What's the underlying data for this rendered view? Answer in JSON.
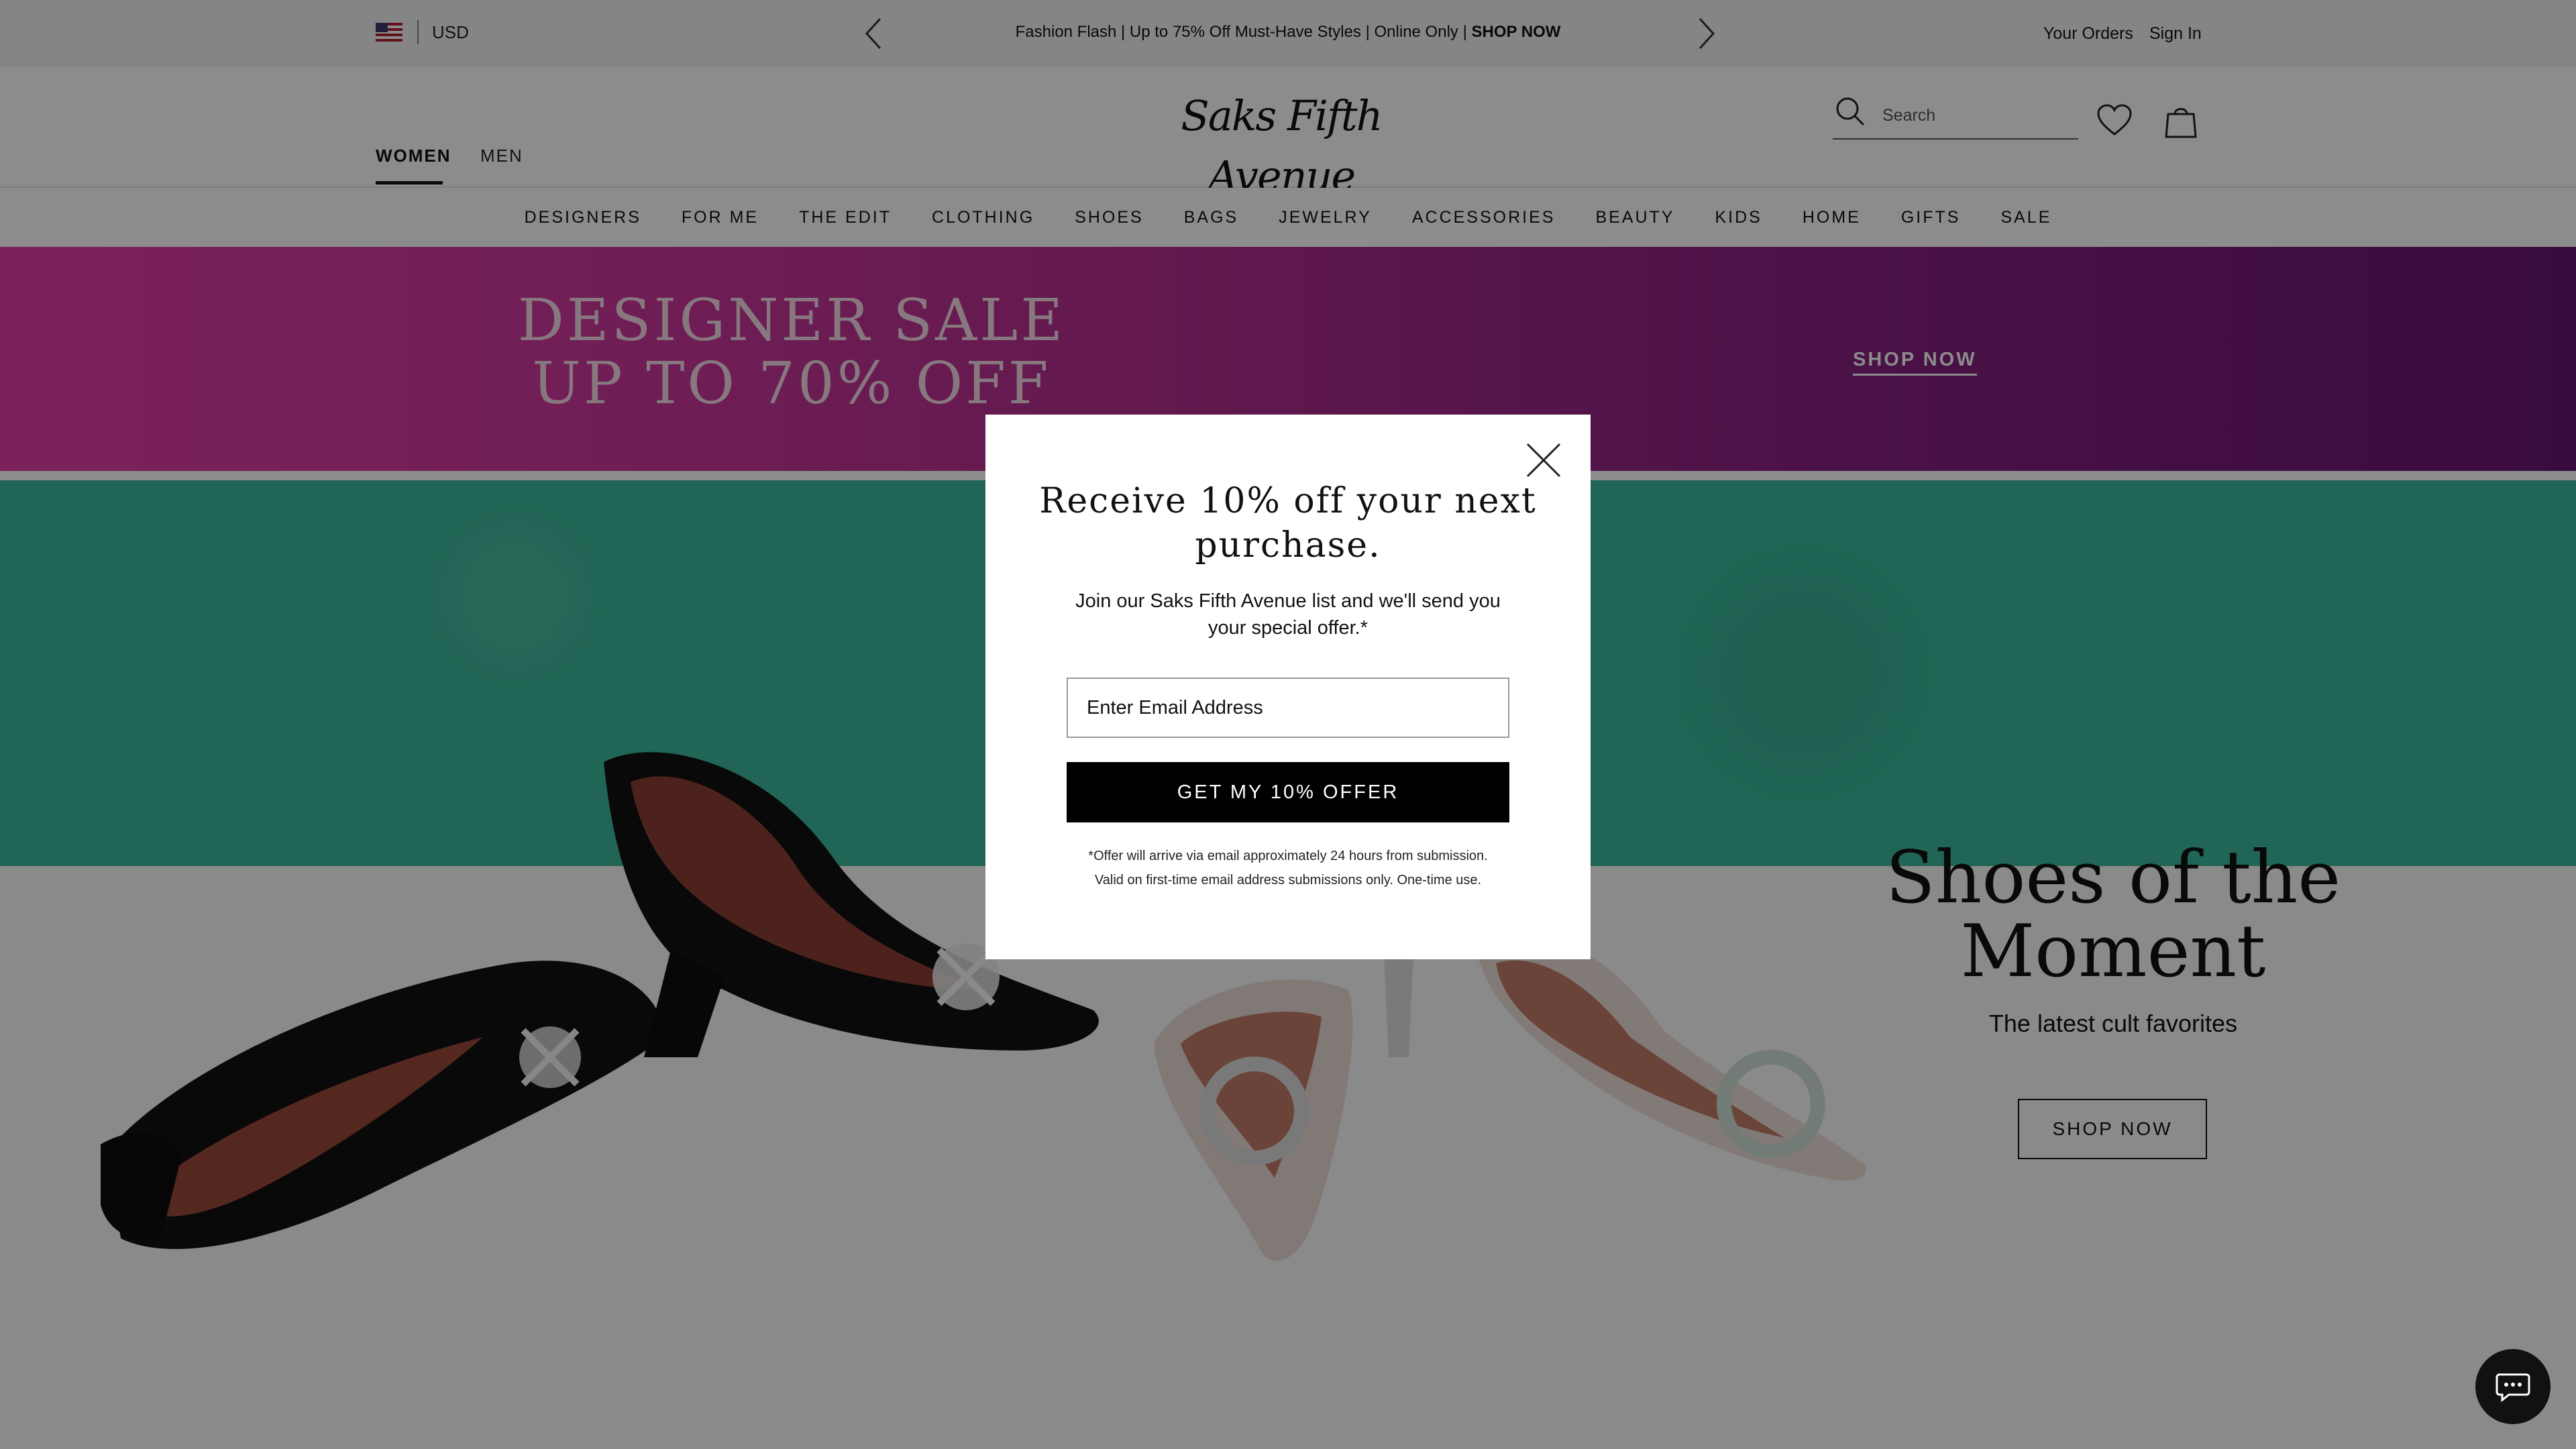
{
  "topbar": {
    "currency": "USD",
    "promo_text": "Fashion Flash | Up to 75% Off Must-Have Styles | Online Only | ",
    "promo_cta": "SHOP NOW",
    "your_orders": "Your Orders",
    "sign_in": "Sign In"
  },
  "header": {
    "logo": "Saks Fifth Avenue",
    "gender_tabs": [
      "WOMEN",
      "MEN"
    ],
    "search_placeholder": "Search"
  },
  "nav": {
    "items": [
      "DESIGNERS",
      "FOR ME",
      "THE EDIT",
      "CLOTHING",
      "SHOES",
      "BAGS",
      "JEWELRY",
      "ACCESSORIES",
      "BEAUTY",
      "KIDS",
      "HOME",
      "GIFTS",
      "SALE"
    ]
  },
  "banner": {
    "line1": "DESIGNER SALE",
    "line2": "UP TO 70% OFF",
    "cta": "SHOP NOW",
    "color_start": "#e23ca8",
    "color_end": "#6a1672"
  },
  "hero": {
    "title": "Shoes of the Moment",
    "subtitle": "The latest cult favorites",
    "cta": "SHOP NOW",
    "wall_color": "#3bb89b"
  },
  "modal": {
    "title": "Receive 10% off your next purchase.",
    "body": "Join our Saks Fifth Avenue list and we'll send you your special offer.*",
    "email_placeholder": "Enter Email Address",
    "submit": "GET MY 10% OFFER",
    "fine_line1": "*Offer will arrive via email approximately 24 hours from submission.",
    "fine_line2": "Valid on first-time email address submissions only. One-time use."
  },
  "icons": {
    "flag": "us-flag-icon",
    "prev": "chevron-left-icon",
    "next": "chevron-right-icon",
    "search": "search-icon",
    "wishlist": "heart-icon",
    "bag": "shopping-bag-icon",
    "close": "close-icon",
    "chat": "chat-icon"
  }
}
